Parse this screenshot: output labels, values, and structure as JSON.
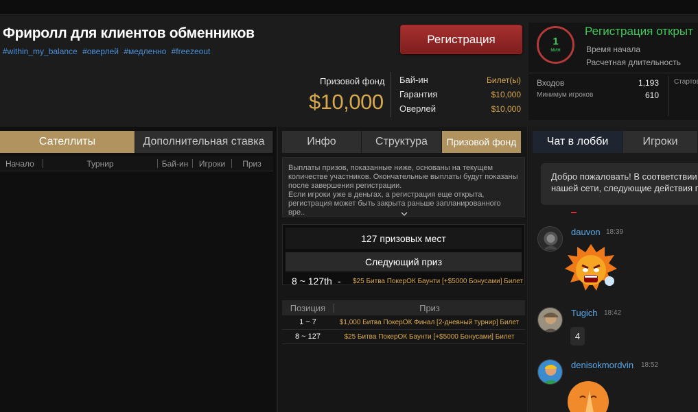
{
  "header": {
    "title": "Фриролл для клиентов обменников",
    "tags": [
      "#within_my_balance",
      "#оверлей",
      "#медленно",
      "#freezeout"
    ],
    "register_label": "Регистрация",
    "prize_pool_label": "Призовой фонд",
    "prize_pool_value": "$10,000",
    "info": {
      "buyin_label": "Бай-ин",
      "buyin_value": "Билет(ы)",
      "guarantee_label": "Гарантия",
      "guarantee_value": "$10,000",
      "overlay_label": "Оверлей",
      "overlay_value": "$10,000"
    }
  },
  "status": {
    "timer_value": "1",
    "timer_unit": "мин",
    "registration_status": "Регистрация открыт",
    "start_time_label": "Время начала",
    "duration_label": "Расчетная длительность",
    "entries_label": "Входов",
    "entries_value": "1,193",
    "min_players_label": "Минимум игроков",
    "min_players_value": "610",
    "starting_stack_label": "Стартов"
  },
  "left_panel": {
    "tabs": [
      "Сателлиты",
      "Дополнительная ставка"
    ],
    "columns": [
      "Начало",
      "Турнир",
      "Бай-ин",
      "Игроки",
      "Приз"
    ]
  },
  "mid_panel": {
    "tabs": [
      "Инфо",
      "Структура",
      "Призовой фонд"
    ],
    "description": "Выплаты призов, показанные ниже, основаны на текущем количестве участников. Окончательные выплаты будут показаны после завершения регистрации.\nЕсли игроки уже в деньгах, а регистрация еще открыта, регистрация может быть закрыта раньше запланированного вре..",
    "paid_places": "127 призовых мест",
    "next_prize_label": "Следующий приз",
    "next_prize_range": "8 ~ 127th",
    "next_prize_dash": "-",
    "next_prize_value": "$25 Битва ПокерОК Баунти [+$5000 Бонусами] Билет",
    "table_columns": [
      "Позиция",
      "Приз"
    ],
    "rows": [
      {
        "position": "1 ~ 7",
        "prize": "$1,000 Битва ПокерОК Финал [2-дневный турнир] Билет"
      },
      {
        "position": "8 ~ 127",
        "prize": "$25 Битва ПокерОК Баунти [+$5000 Бонусами] Билет"
      }
    ]
  },
  "chat": {
    "tabs": [
      "Чат в лобби",
      "Игроки"
    ],
    "welcome": "Добро пожаловать! В соответствии с\nнашей сети, следующие действия пр",
    "messages": [
      {
        "user": "dauvon",
        "time": "18:39",
        "text": ""
      },
      {
        "user": "Tugich",
        "time": "18:42",
        "text": "4"
      },
      {
        "user": "denisokmordvin",
        "time": "18:52",
        "text": ""
      }
    ]
  },
  "colors": {
    "gold": "#d9a94e",
    "green": "#3fc75b",
    "link_blue": "#4a90d9",
    "register_red": "#a83030",
    "active_tab": "#b0935f"
  }
}
